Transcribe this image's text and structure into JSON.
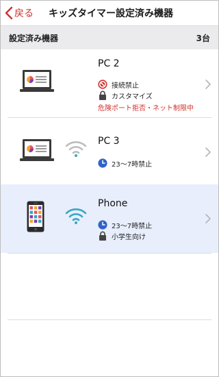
{
  "nav": {
    "back_label": "戻る",
    "title": "キッズタイマー設定済み機器"
  },
  "section": {
    "title": "設定済み機器",
    "count": "3台"
  },
  "devices": [
    {
      "name": "PC 2",
      "statuses": [
        {
          "icon": "block-icon",
          "text": "接続禁止"
        },
        {
          "icon": "lock-icon",
          "text": "カスタマイズ"
        }
      ],
      "warning": "危険ポート拒否・ネット制限中"
    },
    {
      "name": "PC 3",
      "statuses": [
        {
          "icon": "clock-icon",
          "text": "23〜7時禁止"
        }
      ]
    },
    {
      "name": "Phone",
      "statuses": [
        {
          "icon": "clock-icon",
          "text": "23〜7時禁止"
        },
        {
          "icon": "lock-icon",
          "text": "小学生向け"
        }
      ]
    }
  ],
  "colors": {
    "accent": "#d0312d",
    "selected_row": "#e8eefb",
    "section_bg": "#ebebed",
    "wifi_active": "#37a6c4",
    "wifi_inactive": "#bdbdbd",
    "clock": "#2f64c8"
  }
}
